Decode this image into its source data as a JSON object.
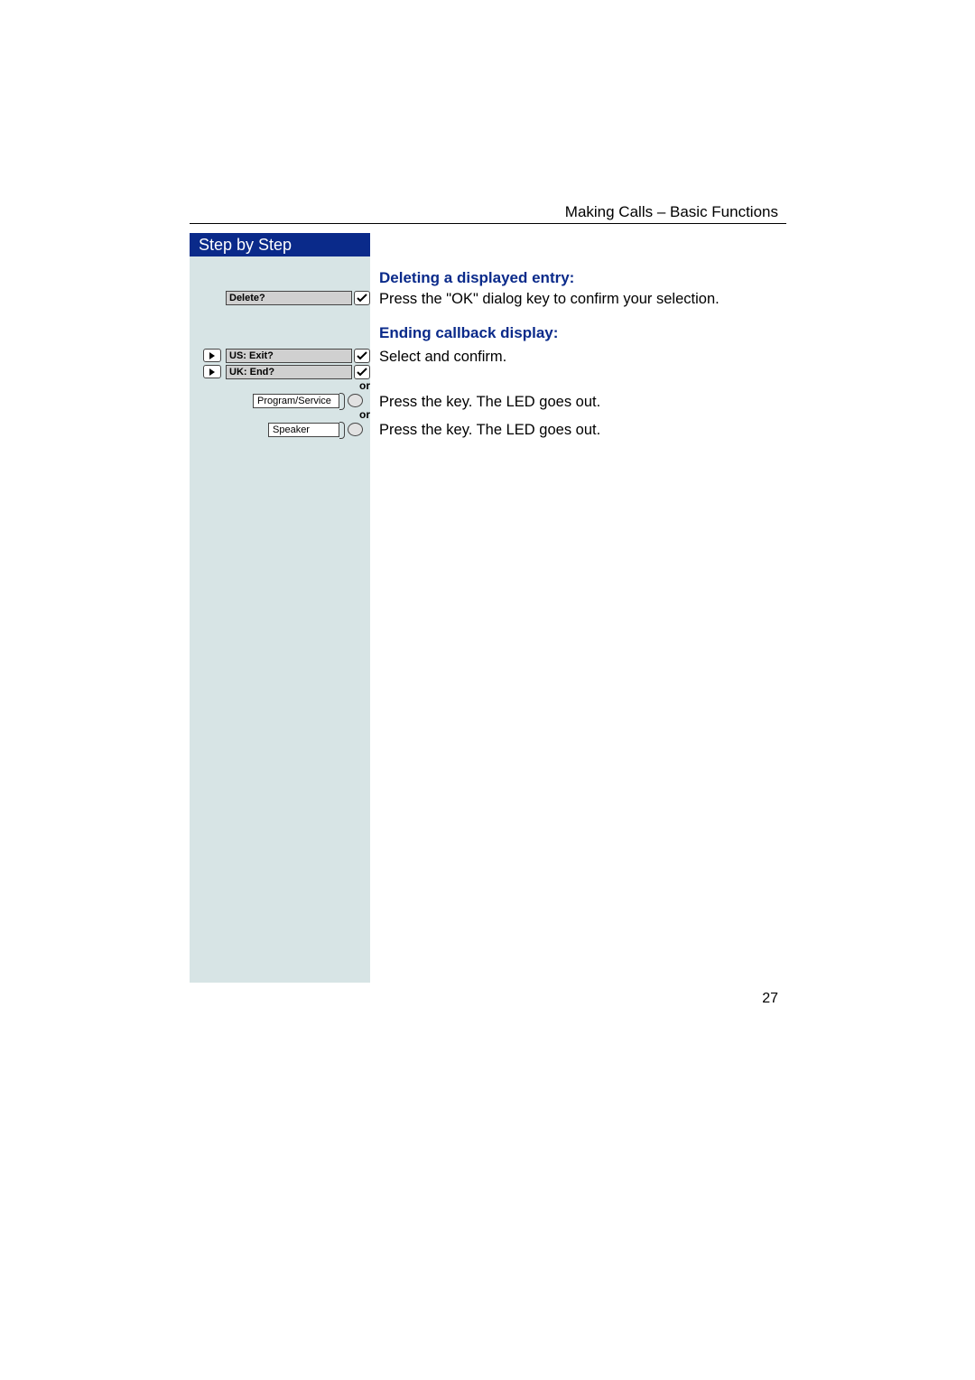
{
  "header": {
    "running": "Making Calls – Basic Functions"
  },
  "sidebar": {
    "title": "Step by Step"
  },
  "headings": {
    "deleting": "Deleting a displayed entry:",
    "ending": "Ending callback display:"
  },
  "body": {
    "confirm_ok": "Press the \"OK\" dialog key to confirm your selection.",
    "select_confirm": "Select and confirm.",
    "press_led_1": "Press the key. The LED goes out.",
    "press_led_2": "Press the key. The LED goes out."
  },
  "displays": {
    "delete": "Delete?",
    "us_exit": "US: Exit?",
    "uk_end": "UK: End?"
  },
  "keys": {
    "program_service": "Program/Service",
    "speaker": "Speaker"
  },
  "connector": {
    "or": "or"
  },
  "page_number": "27"
}
